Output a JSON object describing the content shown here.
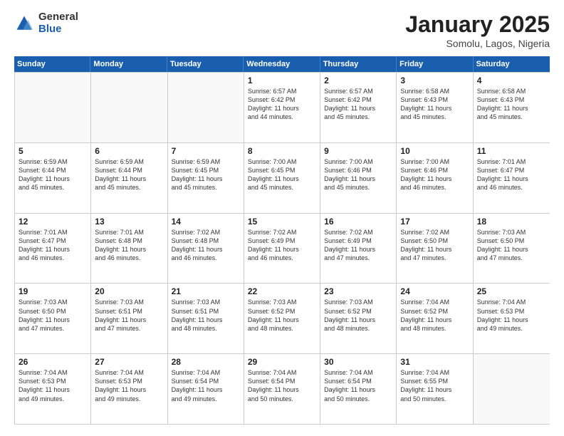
{
  "logo": {
    "general": "General",
    "blue": "Blue"
  },
  "header": {
    "month": "January 2025",
    "location": "Somolu, Lagos, Nigeria"
  },
  "weekdays": [
    "Sunday",
    "Monday",
    "Tuesday",
    "Wednesday",
    "Thursday",
    "Friday",
    "Saturday"
  ],
  "weeks": [
    [
      {
        "day": "",
        "lines": [],
        "empty": true
      },
      {
        "day": "",
        "lines": [],
        "empty": true
      },
      {
        "day": "",
        "lines": [],
        "empty": true
      },
      {
        "day": "1",
        "lines": [
          "Sunrise: 6:57 AM",
          "Sunset: 6:42 PM",
          "Daylight: 11 hours",
          "and 44 minutes."
        ]
      },
      {
        "day": "2",
        "lines": [
          "Sunrise: 6:57 AM",
          "Sunset: 6:42 PM",
          "Daylight: 11 hours",
          "and 45 minutes."
        ]
      },
      {
        "day": "3",
        "lines": [
          "Sunrise: 6:58 AM",
          "Sunset: 6:43 PM",
          "Daylight: 11 hours",
          "and 45 minutes."
        ]
      },
      {
        "day": "4",
        "lines": [
          "Sunrise: 6:58 AM",
          "Sunset: 6:43 PM",
          "Daylight: 11 hours",
          "and 45 minutes."
        ]
      }
    ],
    [
      {
        "day": "5",
        "lines": [
          "Sunrise: 6:59 AM",
          "Sunset: 6:44 PM",
          "Daylight: 11 hours",
          "and 45 minutes."
        ]
      },
      {
        "day": "6",
        "lines": [
          "Sunrise: 6:59 AM",
          "Sunset: 6:44 PM",
          "Daylight: 11 hours",
          "and 45 minutes."
        ]
      },
      {
        "day": "7",
        "lines": [
          "Sunrise: 6:59 AM",
          "Sunset: 6:45 PM",
          "Daylight: 11 hours",
          "and 45 minutes."
        ]
      },
      {
        "day": "8",
        "lines": [
          "Sunrise: 7:00 AM",
          "Sunset: 6:45 PM",
          "Daylight: 11 hours",
          "and 45 minutes."
        ]
      },
      {
        "day": "9",
        "lines": [
          "Sunrise: 7:00 AM",
          "Sunset: 6:46 PM",
          "Daylight: 11 hours",
          "and 45 minutes."
        ]
      },
      {
        "day": "10",
        "lines": [
          "Sunrise: 7:00 AM",
          "Sunset: 6:46 PM",
          "Daylight: 11 hours",
          "and 46 minutes."
        ]
      },
      {
        "day": "11",
        "lines": [
          "Sunrise: 7:01 AM",
          "Sunset: 6:47 PM",
          "Daylight: 11 hours",
          "and 46 minutes."
        ]
      }
    ],
    [
      {
        "day": "12",
        "lines": [
          "Sunrise: 7:01 AM",
          "Sunset: 6:47 PM",
          "Daylight: 11 hours",
          "and 46 minutes."
        ]
      },
      {
        "day": "13",
        "lines": [
          "Sunrise: 7:01 AM",
          "Sunset: 6:48 PM",
          "Daylight: 11 hours",
          "and 46 minutes."
        ]
      },
      {
        "day": "14",
        "lines": [
          "Sunrise: 7:02 AM",
          "Sunset: 6:48 PM",
          "Daylight: 11 hours",
          "and 46 minutes."
        ]
      },
      {
        "day": "15",
        "lines": [
          "Sunrise: 7:02 AM",
          "Sunset: 6:49 PM",
          "Daylight: 11 hours",
          "and 46 minutes."
        ]
      },
      {
        "day": "16",
        "lines": [
          "Sunrise: 7:02 AM",
          "Sunset: 6:49 PM",
          "Daylight: 11 hours",
          "and 47 minutes."
        ]
      },
      {
        "day": "17",
        "lines": [
          "Sunrise: 7:02 AM",
          "Sunset: 6:50 PM",
          "Daylight: 11 hours",
          "and 47 minutes."
        ]
      },
      {
        "day": "18",
        "lines": [
          "Sunrise: 7:03 AM",
          "Sunset: 6:50 PM",
          "Daylight: 11 hours",
          "and 47 minutes."
        ]
      }
    ],
    [
      {
        "day": "19",
        "lines": [
          "Sunrise: 7:03 AM",
          "Sunset: 6:50 PM",
          "Daylight: 11 hours",
          "and 47 minutes."
        ]
      },
      {
        "day": "20",
        "lines": [
          "Sunrise: 7:03 AM",
          "Sunset: 6:51 PM",
          "Daylight: 11 hours",
          "and 47 minutes."
        ]
      },
      {
        "day": "21",
        "lines": [
          "Sunrise: 7:03 AM",
          "Sunset: 6:51 PM",
          "Daylight: 11 hours",
          "and 48 minutes."
        ]
      },
      {
        "day": "22",
        "lines": [
          "Sunrise: 7:03 AM",
          "Sunset: 6:52 PM",
          "Daylight: 11 hours",
          "and 48 minutes."
        ]
      },
      {
        "day": "23",
        "lines": [
          "Sunrise: 7:03 AM",
          "Sunset: 6:52 PM",
          "Daylight: 11 hours",
          "and 48 minutes."
        ]
      },
      {
        "day": "24",
        "lines": [
          "Sunrise: 7:04 AM",
          "Sunset: 6:52 PM",
          "Daylight: 11 hours",
          "and 48 minutes."
        ]
      },
      {
        "day": "25",
        "lines": [
          "Sunrise: 7:04 AM",
          "Sunset: 6:53 PM",
          "Daylight: 11 hours",
          "and 49 minutes."
        ]
      }
    ],
    [
      {
        "day": "26",
        "lines": [
          "Sunrise: 7:04 AM",
          "Sunset: 6:53 PM",
          "Daylight: 11 hours",
          "and 49 minutes."
        ]
      },
      {
        "day": "27",
        "lines": [
          "Sunrise: 7:04 AM",
          "Sunset: 6:53 PM",
          "Daylight: 11 hours",
          "and 49 minutes."
        ]
      },
      {
        "day": "28",
        "lines": [
          "Sunrise: 7:04 AM",
          "Sunset: 6:54 PM",
          "Daylight: 11 hours",
          "and 49 minutes."
        ]
      },
      {
        "day": "29",
        "lines": [
          "Sunrise: 7:04 AM",
          "Sunset: 6:54 PM",
          "Daylight: 11 hours",
          "and 50 minutes."
        ]
      },
      {
        "day": "30",
        "lines": [
          "Sunrise: 7:04 AM",
          "Sunset: 6:54 PM",
          "Daylight: 11 hours",
          "and 50 minutes."
        ]
      },
      {
        "day": "31",
        "lines": [
          "Sunrise: 7:04 AM",
          "Sunset: 6:55 PM",
          "Daylight: 11 hours",
          "and 50 minutes."
        ]
      },
      {
        "day": "",
        "lines": [],
        "empty": true
      }
    ]
  ]
}
